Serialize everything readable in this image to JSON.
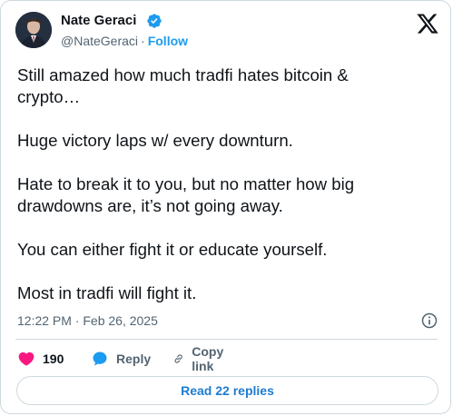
{
  "author": {
    "name": "Nate Geraci",
    "handle": "@NateGeraci",
    "separator": "·",
    "follow_label": "Follow"
  },
  "tweet": {
    "paragraphs": [
      "Still amazed how much tradfi hates bitcoin &\ncrypto…",
      "Huge victory laps w/ every downturn.",
      "Hate to break it to you, but no matter how big\ndrawdowns are, it’s not going away.",
      "You can either fight it or educate yourself.",
      "Most in tradfi will fight it."
    ],
    "timestamp": "12:22 PM · Feb 26, 2025"
  },
  "actions": {
    "like_count": "190",
    "reply_label": "Reply",
    "copy_link_label": "Copy link"
  },
  "read_replies_label": "Read 22 replies",
  "colors": {
    "accent": "#1d9bf0",
    "like": "#f91880",
    "text": "#0f1419",
    "muted": "#536471",
    "border": "#cfd9de"
  },
  "icons": [
    "verified-badge-icon",
    "x-logo-icon",
    "info-icon",
    "heart-icon",
    "reply-bubble-icon",
    "link-icon"
  ]
}
